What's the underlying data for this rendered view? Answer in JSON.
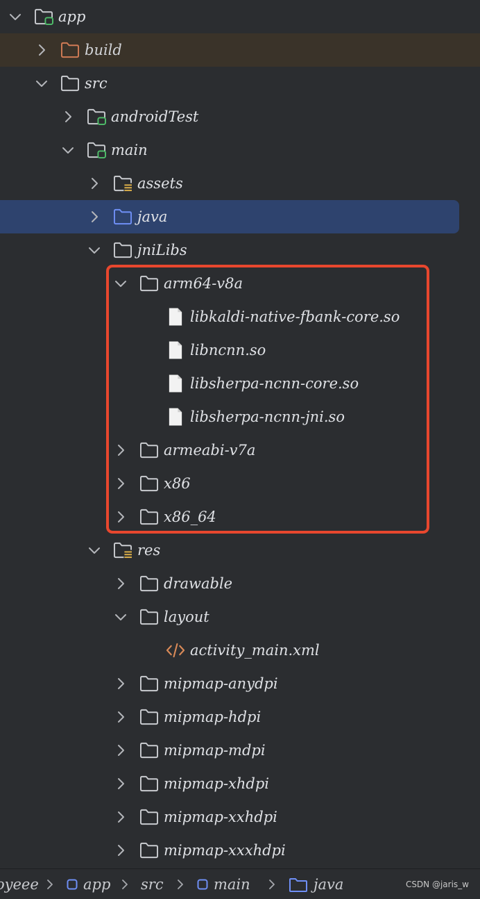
{
  "colors": {
    "background": "#2b2d30",
    "selection": "#2e436e",
    "excluded_row": "#3a3329",
    "highlight_border": "#e8472e",
    "module_badge": "#4fbf6a",
    "build_folder": "#d07b55",
    "java_folder": "#6f8ff5",
    "resource_lines": "#e0b34a",
    "xml_icon": "#d98a58"
  },
  "tree": [
    {
      "label": "app",
      "icon": "module-folder-icon",
      "chevron": "expanded",
      "level": 0
    },
    {
      "label": "build",
      "icon": "excluded-folder-icon",
      "chevron": "collapsed",
      "level": 1,
      "state": "excluded"
    },
    {
      "label": "src",
      "icon": "folder-icon",
      "chevron": "expanded",
      "level": 1
    },
    {
      "label": "androidTest",
      "icon": "module-folder-icon",
      "chevron": "collapsed",
      "level": 2
    },
    {
      "label": "main",
      "icon": "module-folder-icon",
      "chevron": "expanded",
      "level": 2
    },
    {
      "label": "assets",
      "icon": "resource-folder-icon",
      "chevron": "collapsed",
      "level": 3
    },
    {
      "label": "java",
      "icon": "source-folder-icon",
      "chevron": "collapsed",
      "level": 3,
      "state": "selected"
    },
    {
      "label": "jniLibs",
      "icon": "folder-icon",
      "chevron": "expanded",
      "level": 3
    },
    {
      "label": "arm64-v8a",
      "icon": "folder-icon",
      "chevron": "expanded",
      "level": 4
    },
    {
      "label": "libkaldi-native-fbank-core.so",
      "icon": "file-icon",
      "chevron": "none",
      "level": 5
    },
    {
      "label": "libncnn.so",
      "icon": "file-icon",
      "chevron": "none",
      "level": 5
    },
    {
      "label": "libsherpa-ncnn-core.so",
      "icon": "file-icon",
      "chevron": "none",
      "level": 5
    },
    {
      "label": "libsherpa-ncnn-jni.so",
      "icon": "file-icon",
      "chevron": "none",
      "level": 5
    },
    {
      "label": "armeabi-v7a",
      "icon": "folder-icon",
      "chevron": "collapsed",
      "level": 4
    },
    {
      "label": "x86",
      "icon": "folder-icon",
      "chevron": "collapsed",
      "level": 4
    },
    {
      "label": "x86_64",
      "icon": "folder-icon",
      "chevron": "collapsed",
      "level": 4
    },
    {
      "label": "res",
      "icon": "resource-folder-icon",
      "chevron": "expanded",
      "level": 3
    },
    {
      "label": "drawable",
      "icon": "folder-icon",
      "chevron": "collapsed",
      "level": 4
    },
    {
      "label": "layout",
      "icon": "folder-icon",
      "chevron": "expanded",
      "level": 4
    },
    {
      "label": "activity_main.xml",
      "icon": "xml-file-icon",
      "chevron": "none",
      "level": 5
    },
    {
      "label": "mipmap-anydpi",
      "icon": "folder-icon",
      "chevron": "collapsed",
      "level": 4
    },
    {
      "label": "mipmap-hdpi",
      "icon": "folder-icon",
      "chevron": "collapsed",
      "level": 4
    },
    {
      "label": "mipmap-mdpi",
      "icon": "folder-icon",
      "chevron": "collapsed",
      "level": 4
    },
    {
      "label": "mipmap-xhdpi",
      "icon": "folder-icon",
      "chevron": "collapsed",
      "level": 4
    },
    {
      "label": "mipmap-xxhdpi",
      "icon": "folder-icon",
      "chevron": "collapsed",
      "level": 4
    },
    {
      "label": "mipmap-xxxhdpi",
      "icon": "folder-icon",
      "chevron": "collapsed",
      "level": 4
    }
  ],
  "breadcrumb": {
    "items": [
      "oyeee",
      "app",
      "src",
      "main",
      "java"
    ]
  },
  "watermark": "CSDN @jaris_w"
}
